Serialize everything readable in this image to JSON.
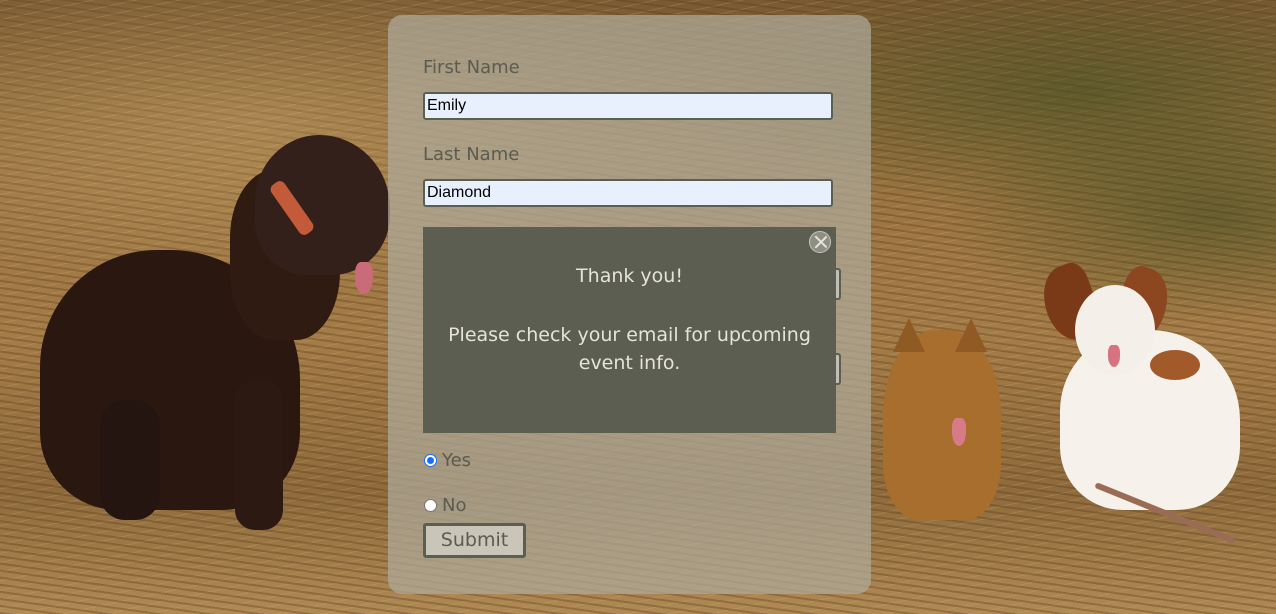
{
  "form": {
    "first_name_label": "First Name",
    "first_name_value": "Emily",
    "last_name_label": "Last Name",
    "last_name_value": "Diamond",
    "radio_options": [
      {
        "label": "Yes",
        "checked": true
      },
      {
        "label": "No",
        "checked": false
      }
    ],
    "submit_label": "Submit"
  },
  "modal": {
    "title": "Thank you!",
    "message": "Please check your email for upcoming event info."
  },
  "colors": {
    "card_bg": "#afaa9b",
    "modal_bg": "#5c5e52",
    "input_bg": "#e8f0fe",
    "radio_accent": "#1a6ef5"
  }
}
